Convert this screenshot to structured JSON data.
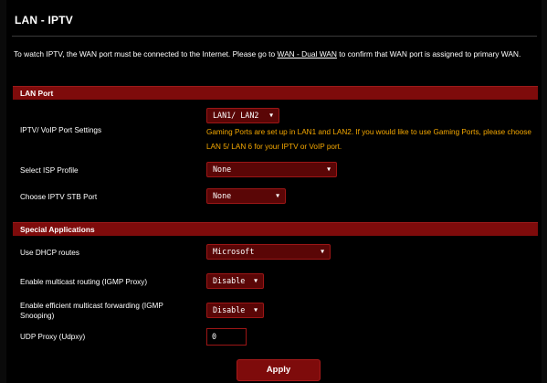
{
  "page": {
    "title": "LAN - IPTV",
    "desc_part1": "To watch IPTV, the WAN port must be connected to the Internet. Please go to ",
    "desc_link": "WAN - Dual WAN",
    "desc_part2": " to confirm that WAN port is assigned to primary WAN."
  },
  "lan_port": {
    "header": "LAN Port",
    "iptv_voip_label": "IPTV/ VoIP Port Settings",
    "iptv_voip_value": "LAN1/ LAN2",
    "gaming_note": "Gaming Ports are set up in LAN1 and LAN2. If you would like to use Gaming Ports, please choose LAN 5/ LAN 6 for your IPTV or VoIP port.",
    "isp_label": "Select ISP Profile",
    "isp_value": "None",
    "stb_label": "Choose IPTV STB Port",
    "stb_value": "None"
  },
  "special": {
    "header": "Special Applications",
    "dhcp_label": "Use DHCP routes",
    "dhcp_value": "Microsoft",
    "multicast_label": "Enable multicast routing (IGMP Proxy)",
    "multicast_value": "Disable",
    "snooping_label": "Enable efficient multicast forwarding (IGMP Snooping)",
    "snooping_value": "Disable",
    "udp_label": "UDP Proxy (Udpxy)",
    "udp_value": "0"
  },
  "actions": {
    "apply_label": "Apply"
  },
  "icons": {
    "dropdown": "caret-down-icon"
  },
  "colors": {
    "accent": "#7e0b0b",
    "note": "#f5a800",
    "background": "#000000"
  }
}
